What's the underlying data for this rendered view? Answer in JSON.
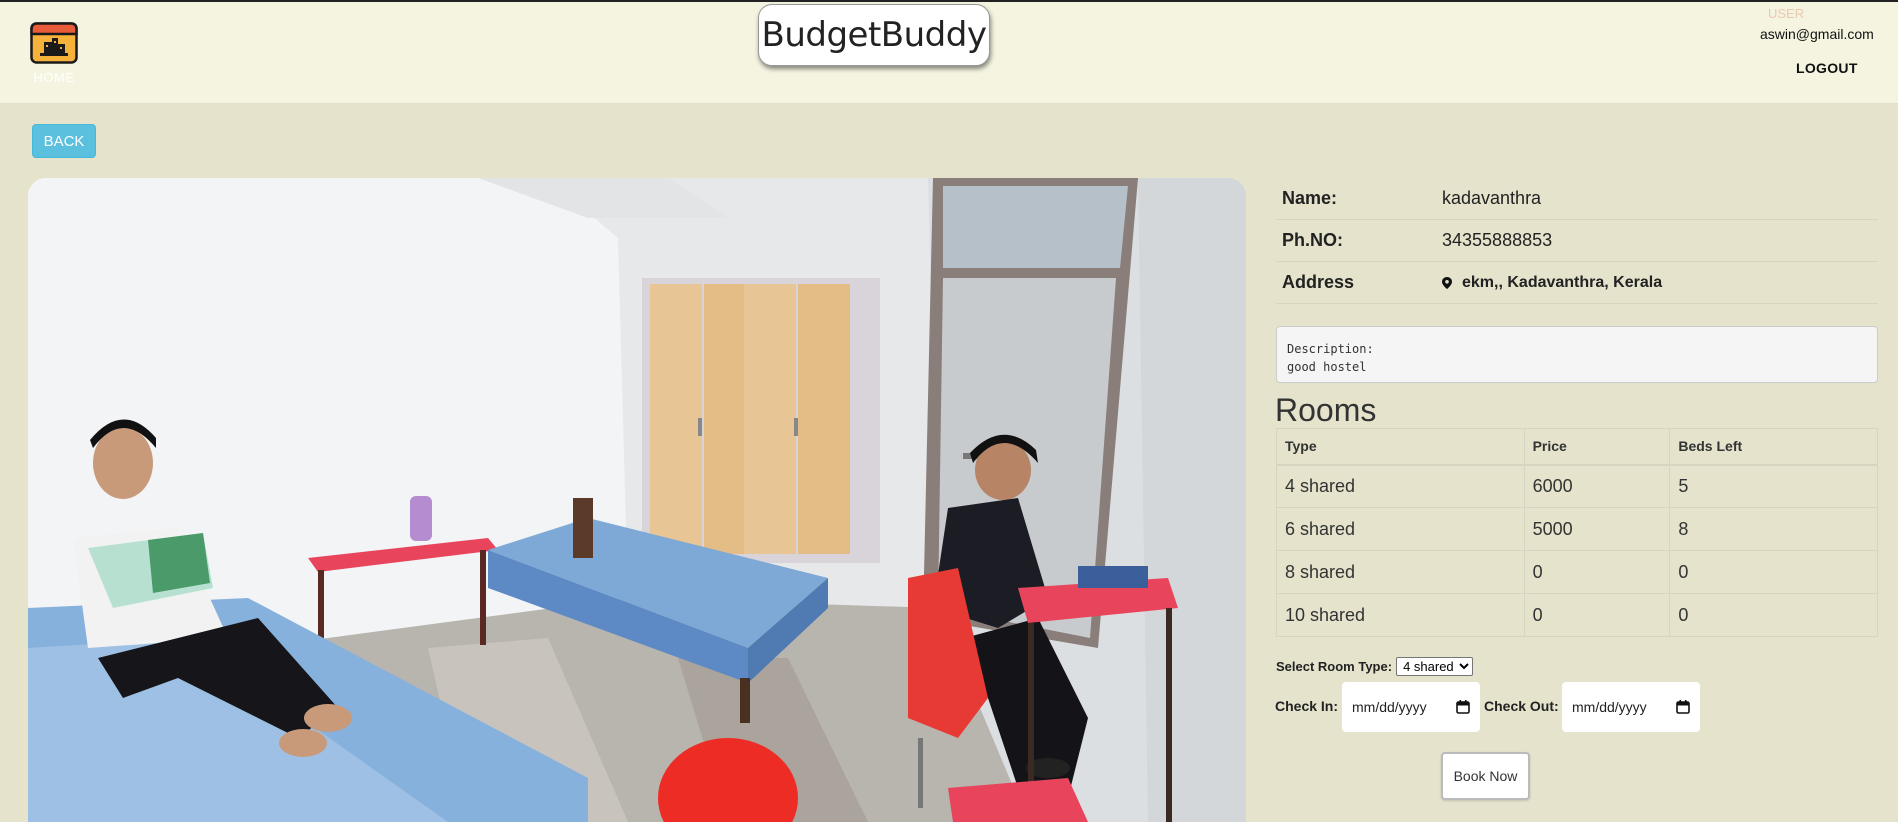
{
  "nav": {
    "home_label": "HOME",
    "brand": "BudgetBuddy",
    "user_label": "USER",
    "user_email": "aswin@gmail.com",
    "logout_label": "LOGOUT"
  },
  "back_label": "BACK",
  "hostel": {
    "name_key": "Name:",
    "name": "kadavanthra",
    "phone_key": "Ph.NO:",
    "phone": "34355888853",
    "address_key": "Address",
    "address": "ekm,, Kadavanthra, Kerala",
    "description_label": "Description:",
    "description": "good hostel"
  },
  "rooms": {
    "title": "Rooms",
    "headers": [
      "Type",
      "Price",
      "Beds Left"
    ],
    "rows": [
      [
        "4 shared",
        "6000",
        "5"
      ],
      [
        "6 shared",
        "5000",
        "8"
      ],
      [
        "8 shared",
        "0",
        "0"
      ],
      [
        "10 shared",
        "0",
        "0"
      ]
    ]
  },
  "booking": {
    "select_label": "Select Room Type:",
    "selected_type": "4 shared",
    "checkin_label": "Check In:",
    "checkin_placeholder": "mm/dd/yyyy",
    "checkout_label": "Check Out:",
    "checkout_placeholder": "mm/dd/yyyy",
    "book_label": "Book Now"
  },
  "colors": {
    "page_bg": "#e5e3cc",
    "navbar_bg": "#f5f4e0",
    "back_button": "#5bc0de"
  },
  "icons": {
    "home": "home-icon",
    "address": "map-pin-icon",
    "calendar": "calendar-icon"
  }
}
